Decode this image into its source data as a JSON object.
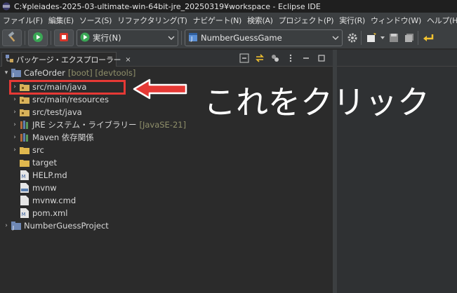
{
  "window": {
    "title": "C:¥pleiades-2025-03-ultimate-win-64bit-jre_20250319¥workspace - Eclipse IDE"
  },
  "menubar": {
    "items": [
      "ファイル(F)",
      "編集(E)",
      "ソース(S)",
      "リファクタリング(T)",
      "ナビゲート(N)",
      "検索(A)",
      "プロジェクト(P)",
      "実行(R)",
      "ウィンドウ(W)",
      "ヘルプ(H)"
    ]
  },
  "toolbar": {
    "run_config": "実行(N)",
    "launch_target": "NumberGuessGame"
  },
  "view": {
    "tab_label": "パッケージ・エクスプローラー",
    "close_symbol": "×"
  },
  "tree": [
    {
      "label": "CafeOrder",
      "decoration": "[boot] [devtools]",
      "icon": "project-icon",
      "expanded": true
    },
    {
      "label": "src/main/java",
      "icon": "source-folder-icon"
    },
    {
      "label": "src/main/resources",
      "icon": "source-folder-icon"
    },
    {
      "label": "src/test/java",
      "icon": "source-folder-icon"
    },
    {
      "label": "JRE システム・ライブラリー",
      "decoration": "[JavaSE-21]",
      "icon": "library-icon"
    },
    {
      "label": "Maven 依存関係",
      "icon": "library-icon"
    },
    {
      "label": "src",
      "icon": "folder-icon"
    },
    {
      "label": "target",
      "icon": "folder-icon"
    },
    {
      "label": "HELP.md",
      "icon": "markdown-file-icon"
    },
    {
      "label": "mvnw",
      "icon": "file-icon"
    },
    {
      "label": "mvnw.cmd",
      "icon": "file-icon"
    },
    {
      "label": "pom.xml",
      "icon": "xml-file-icon"
    },
    {
      "label": "NumberGuessProject",
      "icon": "project-icon",
      "expanded": false
    }
  ],
  "annotation": {
    "text": "これをクリック"
  },
  "colors": {
    "highlight": "#e53935",
    "background": "#2b2b2b",
    "annotation_text": "#ffffff"
  }
}
